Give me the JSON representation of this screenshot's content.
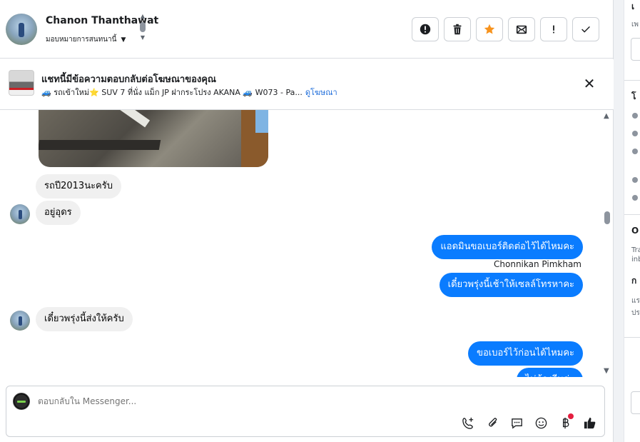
{
  "header": {
    "contact_name": "Chanon Thanthawat",
    "assign_label": "มอบหมายการสนทนานี้",
    "actions": [
      {
        "name": "mark-spam-button",
        "icon": "alert-circle-icon"
      },
      {
        "name": "delete-button",
        "icon": "trash-icon"
      },
      {
        "name": "star-button",
        "icon": "star-icon"
      },
      {
        "name": "mark-unread-button",
        "icon": "envelope-icon"
      },
      {
        "name": "follow-up-button",
        "icon": "exclamation-icon"
      },
      {
        "name": "mark-done-button",
        "icon": "check-icon"
      }
    ]
  },
  "ad_banner": {
    "title": "แชทนี้มีข้อความตอบกลับต่อโฆษณาของคุณ",
    "subtitle": "🚙 รถเข้าใหม่⭐ SUV 7 ที่นั่ง แม็ก JP ฝากระโปรง AKANA 🚙 W073 - Pa...",
    "link_label": "ดูโฆษณา"
  },
  "messages": [
    {
      "direction": "in",
      "text": "รถปี2013นะครับ"
    },
    {
      "direction": "in",
      "text": "อยู่อุดร"
    },
    {
      "direction": "out",
      "text": "แอดมินขอเบอร์ติดต่อไว้ได้ไหมคะ"
    },
    {
      "direction": "out",
      "sender": "Chonnikan Pimkham",
      "text": "เดี๋ยวพรุ่งนี้เช้าให้เซลล์โทรหาคะ"
    },
    {
      "direction": "in",
      "text": "เดี๋ยวพรุ่งนี้ส่งให้ครับ"
    },
    {
      "direction": "out",
      "text": "ขอเบอร์ไว้ก่อนได้ไหมคะ"
    },
    {
      "direction": "out",
      "text": "ไม่ต้องรีบค่ะ"
    }
  ],
  "composer": {
    "placeholder": "ตอบกลับใน Messenger..."
  },
  "composer_tools": [
    "add-call-icon",
    "attachment-icon",
    "saved-reply-icon",
    "emoji-icon",
    "baht-payment-icon",
    "thumbs-up-icon"
  ],
  "colors": {
    "outgoing_bubble": "#0a7cff",
    "incoming_bubble": "#f0f0f0",
    "star_accent": "#f7931e",
    "link": "#216fdb",
    "notification_dot": "#e41e3f"
  }
}
